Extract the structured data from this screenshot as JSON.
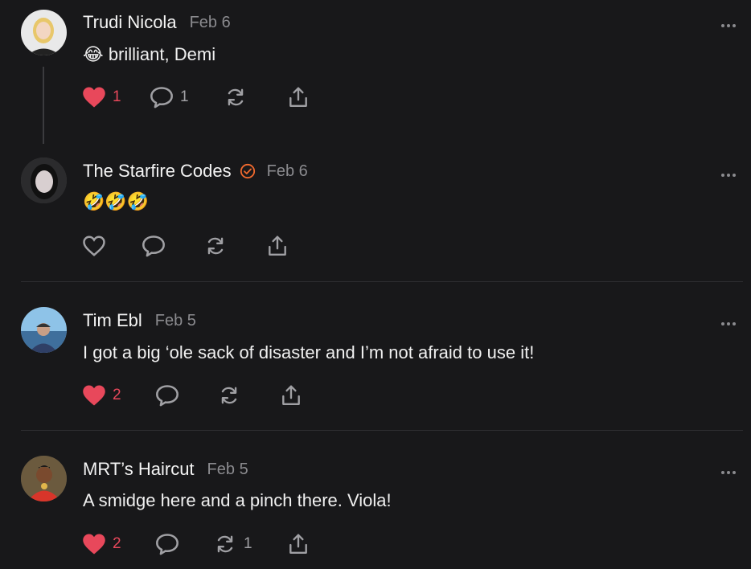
{
  "comments": [
    {
      "author": "Trudi Nicola",
      "date": "Feb 6",
      "verified": false,
      "text": "😂 brilliant, Demi",
      "liked": true,
      "likes": "1",
      "replies": "1",
      "restacks": ""
    },
    {
      "author": "The Starfire Codes",
      "date": "Feb 6",
      "verified": true,
      "text": "🤣🤣🤣",
      "liked": false,
      "likes": "",
      "replies": "",
      "restacks": ""
    },
    {
      "author": "Tim Ebl",
      "date": "Feb 5",
      "verified": false,
      "text": "I got a big ‘ole sack of disaster and I’m not afraid to use it!",
      "liked": true,
      "likes": "2",
      "replies": "",
      "restacks": ""
    },
    {
      "author": "MRT’s Haircut",
      "date": "Feb 5",
      "verified": false,
      "text": "A smidge here and a pinch there. Viola!",
      "liked": true,
      "likes": "2",
      "replies": "",
      "restacks": "1"
    }
  ],
  "colors": {
    "background": "#18181a",
    "like_active": "#e8485b",
    "verified": "#f26a2e",
    "muted": "#8b8b8f"
  },
  "icons": [
    "heart-icon",
    "comment-icon",
    "restack-icon",
    "share-icon",
    "more-icon",
    "verified-icon"
  ]
}
